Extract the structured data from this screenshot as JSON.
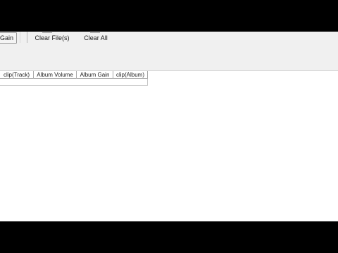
{
  "toolbar": {
    "gain_label": "Gain",
    "clear_files_label": "Clear File(s)",
    "clear_all_label": "Clear All"
  },
  "list": {
    "columns": [
      "clip(Track)",
      "Album Volume",
      "Album Gain",
      "clip(Album)"
    ]
  }
}
